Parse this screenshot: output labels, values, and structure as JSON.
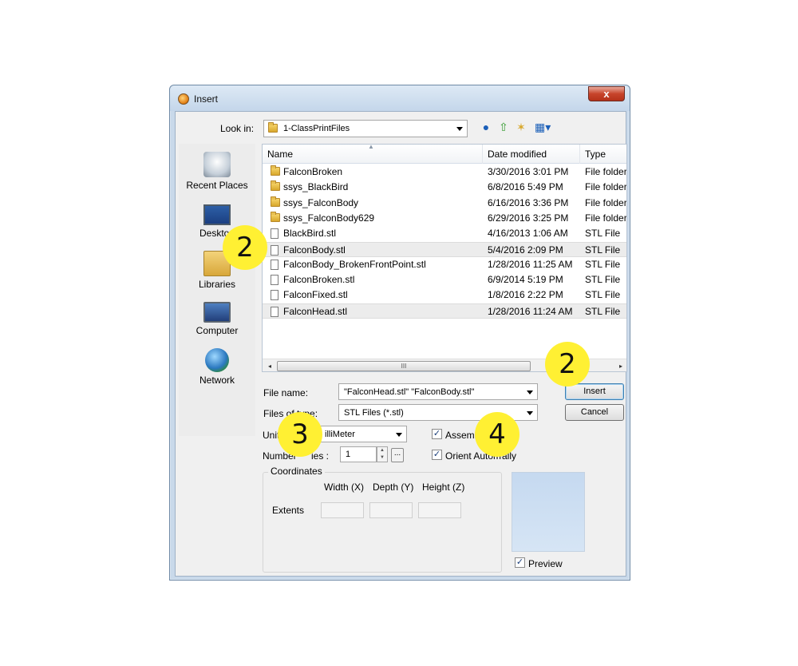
{
  "window": {
    "title": "Insert",
    "close_symbol": "x"
  },
  "lookin": {
    "label": "Look in:",
    "value": "1-ClassPrintFiles"
  },
  "places": [
    {
      "label": "Recent Places",
      "icon": "recent-places-icon"
    },
    {
      "label": "Desktop",
      "icon": "desktop-icon"
    },
    {
      "label": "Libraries",
      "icon": "libraries-icon"
    },
    {
      "label": "Computer",
      "icon": "computer-icon"
    },
    {
      "label": "Network",
      "icon": "network-icon"
    }
  ],
  "columns": {
    "name": "Name",
    "date": "Date modified",
    "type": "Type"
  },
  "files": [
    {
      "name": "FalconBroken",
      "date": "3/30/2016 3:01 PM",
      "type": "File folder",
      "kind": "folder",
      "selected": false
    },
    {
      "name": "ssys_BlackBird",
      "date": "6/8/2016 5:49 PM",
      "type": "File folder",
      "kind": "folder",
      "selected": false
    },
    {
      "name": "ssys_FalconBody",
      "date": "6/16/2016 3:36 PM",
      "type": "File folder",
      "kind": "folder",
      "selected": false
    },
    {
      "name": "ssys_FalconBody629",
      "date": "6/29/2016 3:25 PM",
      "type": "File folder",
      "kind": "folder",
      "selected": false
    },
    {
      "name": "BlackBird.stl",
      "date": "4/16/2013 1:06 AM",
      "type": "STL File",
      "kind": "file",
      "selected": false
    },
    {
      "name": "FalconBody.stl",
      "date": "5/4/2016 2:09 PM",
      "type": "STL File",
      "kind": "file",
      "selected": true
    },
    {
      "name": "FalconBody_BrokenFrontPoint.stl",
      "date": "1/28/2016 11:25 AM",
      "type": "STL File",
      "kind": "file",
      "selected": false
    },
    {
      "name": "FalconBroken.stl",
      "date": "6/9/2014 5:19 PM",
      "type": "STL File",
      "kind": "file",
      "selected": false
    },
    {
      "name": "FalconFixed.stl",
      "date": "1/8/2016 2:22 PM",
      "type": "STL File",
      "kind": "file",
      "selected": false
    },
    {
      "name": "FalconHead.stl",
      "date": "1/28/2016 11:24 AM",
      "type": "STL File",
      "kind": "file",
      "selected": true
    }
  ],
  "scrollbar": {
    "grip": "III",
    "left_arrow": "◂",
    "right_arrow": "▸"
  },
  "form": {
    "filename_label": "File name:",
    "filename_value": "\"FalconHead.stl\" \"FalconBody.stl\"",
    "filetype_label": "Files of type:",
    "filetype_value": "STL Files (*.stl)",
    "insert_label": "Insert",
    "cancel_label": "Cancel",
    "units_label": "Units:",
    "units_value": "illiMeter",
    "assembly_label": "Assembly",
    "number_label": "Number",
    "number_suffix": "ies :",
    "number_value": "1",
    "browse_label": "...",
    "orient_label": "Orient Autom",
    "orient_suffix": "ally",
    "check_mark": "✓"
  },
  "coordinates": {
    "title": "Coordinates",
    "width_label": "Width (X)",
    "depth_label": "Depth (Y)",
    "height_label": "Height (Z)",
    "extents_label": "Extents"
  },
  "preview": {
    "label": "Preview"
  },
  "badges": [
    "2",
    "2",
    "3",
    "4"
  ],
  "colors": {
    "badge": "#fff033",
    "selected_row": "#ececec",
    "title_bar": "#c9d9ea"
  }
}
